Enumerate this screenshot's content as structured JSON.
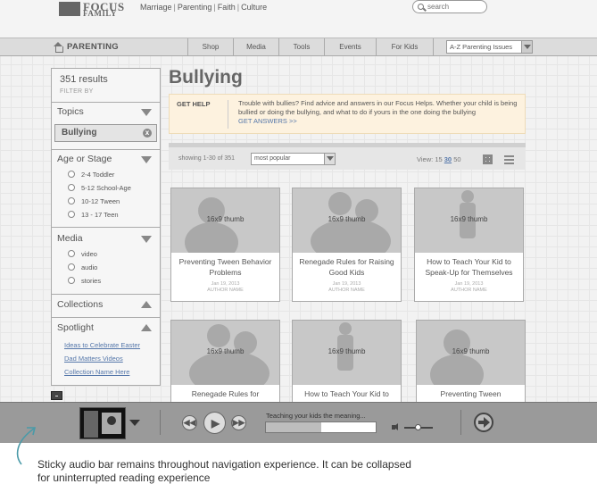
{
  "header": {
    "logo_top": "FOCUS",
    "logo_bottom": "FAMILY",
    "nav": [
      "Marriage",
      "Parenting",
      "Faith",
      "Culture"
    ],
    "search_placeholder": "search"
  },
  "section_bar": {
    "title": "PARENTING",
    "tabs": [
      "Shop",
      "Media",
      "Tools",
      "Events",
      "For Kids"
    ],
    "dropdown_value": "A-Z Parenting Issues"
  },
  "filters": {
    "results": "351 results",
    "filter_by": "FILTER BY",
    "topics": {
      "label": "Topics",
      "selected": "Bullying",
      "clear_glyph": "x"
    },
    "age": {
      "label": "Age or Stage",
      "options": [
        "2-4 Toddler",
        "5-12 School-Age",
        "10-12 Tween",
        "13 - 17 Teen"
      ]
    },
    "media": {
      "label": "Media",
      "options": [
        "video",
        "audio",
        "stories"
      ]
    },
    "collections": {
      "label": "Collections"
    },
    "spotlight": {
      "label": "Spotlight",
      "links": [
        "Ideas to Celebrate Easter",
        "Dad Matters Videos",
        "Collection Name Here"
      ]
    }
  },
  "main": {
    "title": "Bullying",
    "get_help": {
      "label": "GET HELP",
      "text": "Trouble with bullies? Find advice and answers in our Focus Helps. Whether your child is being bullied or doing the bullying, and what to do if yours in the one doing the bullying",
      "link": "GET ANSWERS >>"
    },
    "toolbar": {
      "showing": "showing 1-30 of 351",
      "sort": "most popular",
      "view_label": "View:",
      "view_options": [
        "15",
        "30",
        "50"
      ],
      "view_selected": "30"
    },
    "cards": [
      {
        "thumb": "16x9 thumb",
        "title": "Preventing Tween Behavior Problems",
        "date": "Jan 19, 2013",
        "author": "AUTHOR NAME"
      },
      {
        "thumb": "16x9 thumb",
        "title": "Renegade Rules for Raising Good Kids",
        "date": "Jan 19, 2013",
        "author": "AUTHOR NAME"
      },
      {
        "thumb": "16x9 thumb",
        "title": "How to Teach Your Kid to Speak-Up for Themselves",
        "date": "Jan 19, 2013",
        "author": "AUTHOR NAME"
      },
      {
        "thumb": "16x9 thumb",
        "title": "Renegade Rules for",
        "date": "",
        "author": ""
      },
      {
        "thumb": "16x9 thumb",
        "title": "How to Teach Your Kid to",
        "date": "",
        "author": ""
      },
      {
        "thumb": "16x9 thumb",
        "title": "Preventing Tween",
        "date": "",
        "author": ""
      }
    ]
  },
  "audio_bar": {
    "now_playing": "Teaching your kids the meaning...",
    "progress": 0.5
  },
  "annotation": "Sticky audio bar remains throughout navigation experience. It can be collapsed for uninterrupted reading experience"
}
